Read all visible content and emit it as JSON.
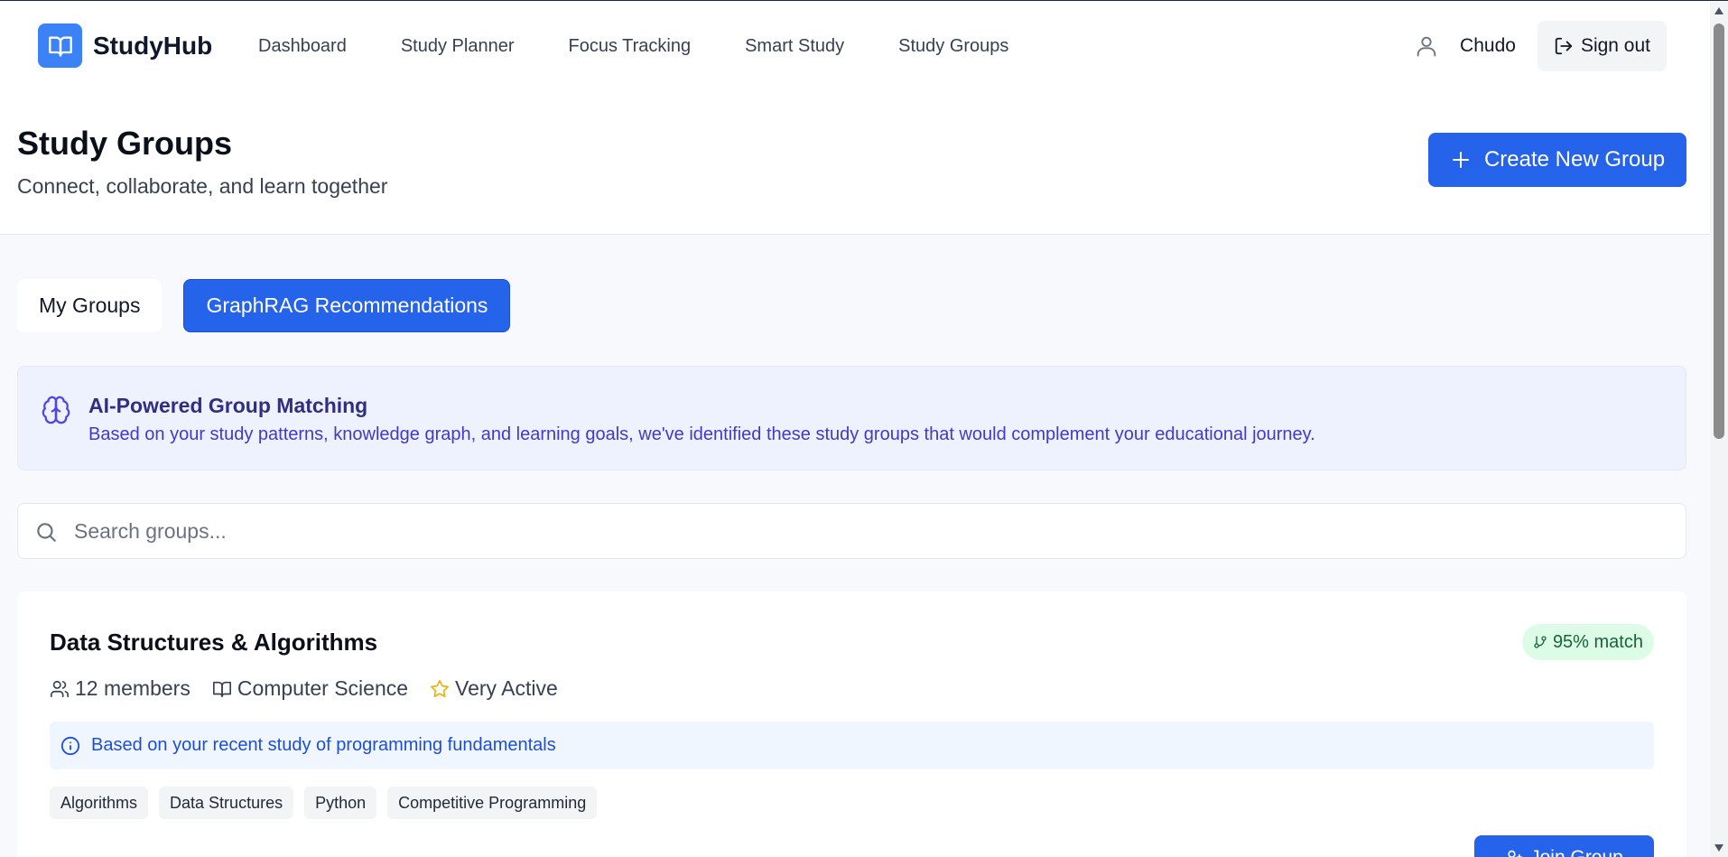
{
  "app": {
    "name": "StudyHub",
    "accent": "#2563eb"
  },
  "nav": {
    "links": [
      "Dashboard",
      "Study Planner",
      "Focus Tracking",
      "Smart Study",
      "Study Groups"
    ],
    "user_name": "Chudo",
    "signout_label": "Sign out"
  },
  "header": {
    "title": "Study Groups",
    "subtitle": "Connect, collaborate, and learn together",
    "create_label": "Create New Group"
  },
  "tabs": [
    {
      "label": "My Groups",
      "active": false
    },
    {
      "label": "GraphRAG Recommendations",
      "active": true
    }
  ],
  "ai_banner": {
    "icon": "brain-icon",
    "title": "AI-Powered Group Matching",
    "description": "Based on your study patterns, knowledge graph, and learning goals, we've identified these study groups that would complement your educational journey."
  },
  "search": {
    "placeholder": "Search groups...",
    "value": ""
  },
  "groups": [
    {
      "name": "Data Structures & Algorithms",
      "match": "95% match",
      "members": "12 members",
      "subject": "Computer Science",
      "activity": "Very Active",
      "reason": "Based on your recent study of programming fundamentals",
      "tags": [
        "Algorithms",
        "Data Structures",
        "Python",
        "Competitive Programming"
      ],
      "join_label": "Join Group"
    }
  ],
  "colors": {
    "primary": "#2563eb",
    "banner_bg": "#eef2ff",
    "match_bg": "#dcfce7",
    "match_text": "#166534",
    "star": "#eab308"
  }
}
